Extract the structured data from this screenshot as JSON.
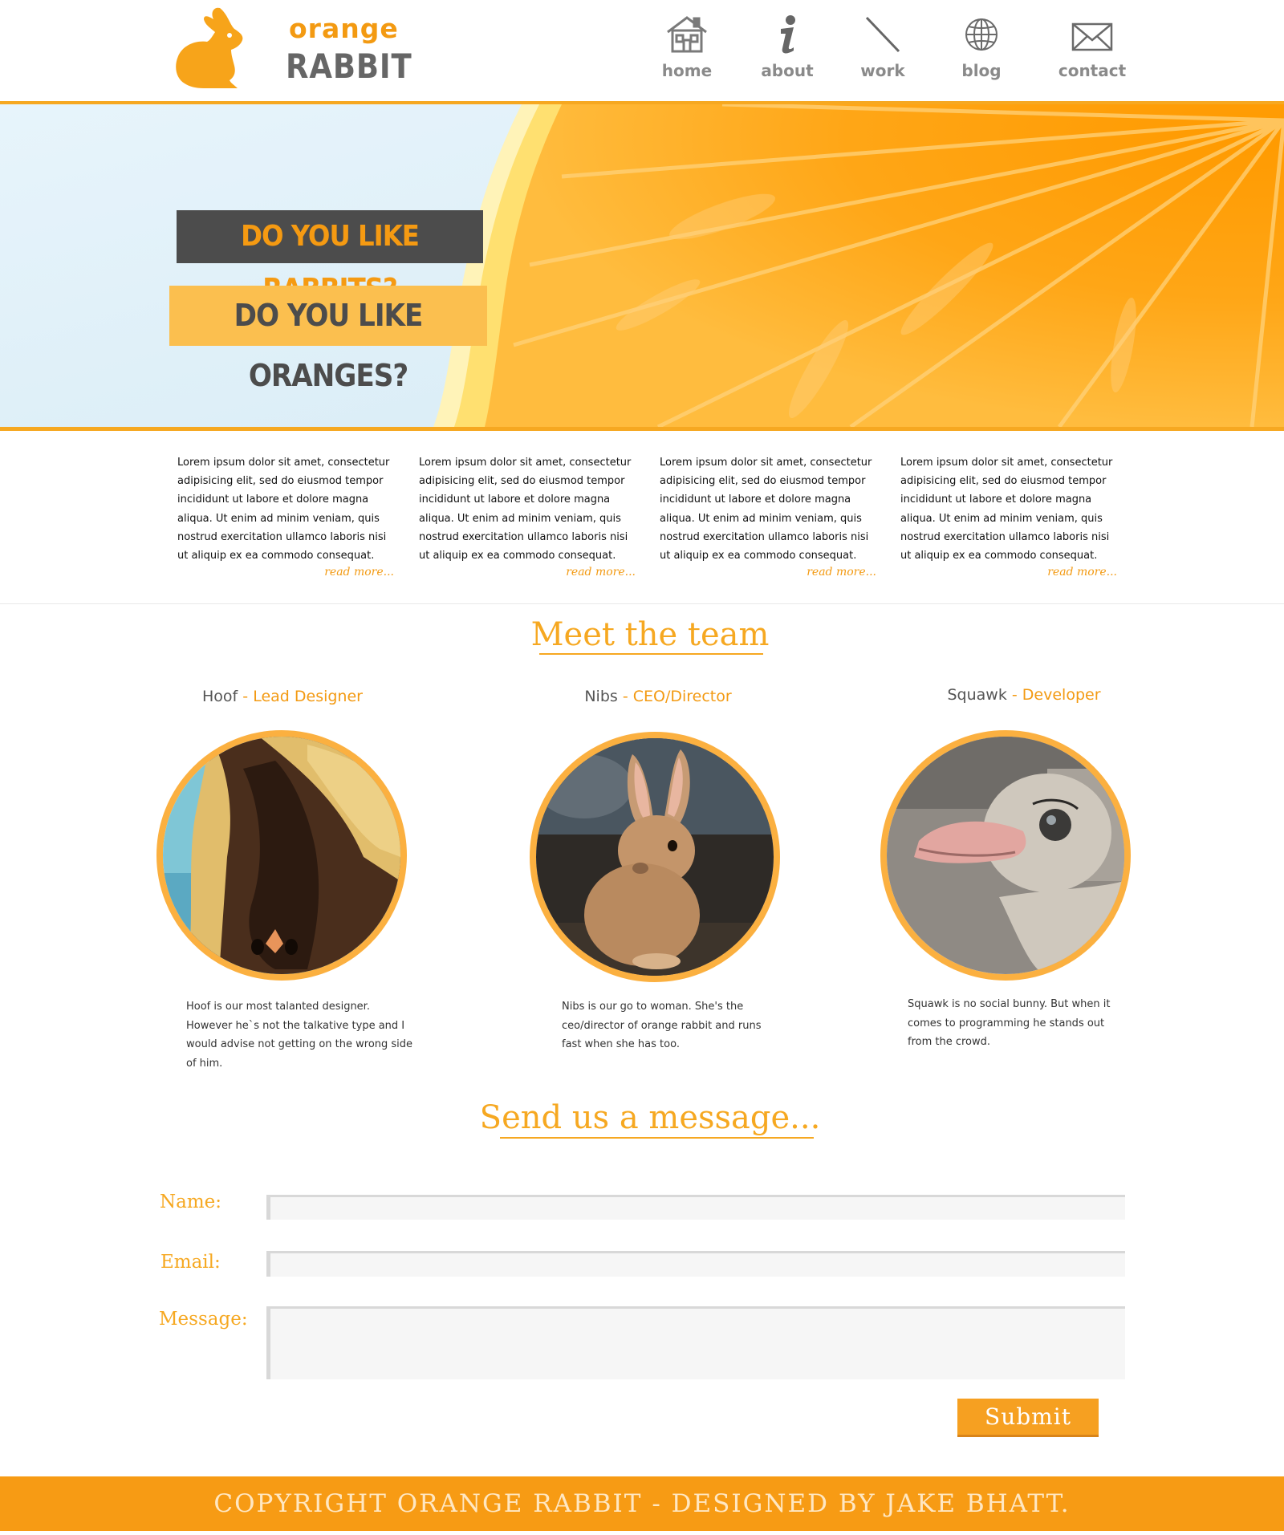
{
  "brand": {
    "line1": "orange",
    "line2": "RABBIT",
    "accent_color": "#f39a12"
  },
  "nav": [
    {
      "label": "home",
      "icon": "home-icon"
    },
    {
      "label": "about",
      "icon": "info-icon"
    },
    {
      "label": "work",
      "icon": "pencil-slash-icon"
    },
    {
      "label": "blog",
      "icon": "globe-icon"
    },
    {
      "label": "contact",
      "icon": "envelope-icon"
    }
  ],
  "hero": {
    "question1": "DO YOU LIKE RABBITS?",
    "question2": "DO YOU LIKE ORANGES?"
  },
  "columns": [
    {
      "text": "Lorem ipsum dolor sit amet, consectetur adipisicing elit, sed do eiusmod tempor incididunt ut labore et dolore magna aliqua. Ut enim ad minim veniam, quis nostrud exercitation ullamco laboris nisi ut aliquip ex ea commodo consequat.",
      "more": "read more..."
    },
    {
      "text": "Lorem ipsum dolor sit amet, consectetur adipisicing elit, sed do eiusmod tempor incididunt ut labore et dolore magna aliqua. Ut enim ad minim veniam, quis nostrud exercitation ullamco laboris nisi ut aliquip ex ea commodo consequat.",
      "more": "read more..."
    },
    {
      "text": "Lorem ipsum dolor sit amet, consectetur adipisicing elit, sed do eiusmod tempor incididunt ut labore et dolore magna aliqua. Ut enim ad minim veniam, quis nostrud exercitation ullamco laboris nisi ut aliquip ex ea commodo consequat.",
      "more": "read more..."
    },
    {
      "text": "Lorem ipsum dolor sit amet, consectetur adipisicing elit, sed do eiusmod tempor incididunt ut labore et dolore magna aliqua. Ut enim ad minim veniam, quis nostrud exercitation ullamco laboris nisi ut aliquip ex ea commodo consequat.",
      "more": "read more..."
    }
  ],
  "team": {
    "heading": "Meet the team",
    "members": [
      {
        "name": "Hoof",
        "separator": " - ",
        "role": "Lead Designer",
        "bio": "Hoof is our most talanted designer. However he`s not the talkative type and I would advise not getting on the wrong side of him.",
        "photo": "horse-photo"
      },
      {
        "name": "Nibs",
        "separator": " - ",
        "role": "CEO/Director",
        "bio": "Nibs is our go to woman. She's the ceo/director of orange rabbit and runs fast when she has too.",
        "photo": "rabbit-photo"
      },
      {
        "name": "Squawk",
        "separator": " - ",
        "role": "Developer",
        "bio": "Squawk is no social bunny. But when it comes to programming he stands out from the crowd.",
        "photo": "ostrich-photo"
      }
    ]
  },
  "contact_form": {
    "heading": "Send us a message...",
    "name_label": "Name:",
    "email_label": "Email:",
    "message_label": "Message:",
    "name_value": "",
    "email_value": "",
    "message_value": "",
    "submit_label": "Submit"
  },
  "footer": {
    "text": "COPYRIGHT ORANGE RABBIT - DESIGNED BY JAKE BHATT."
  }
}
